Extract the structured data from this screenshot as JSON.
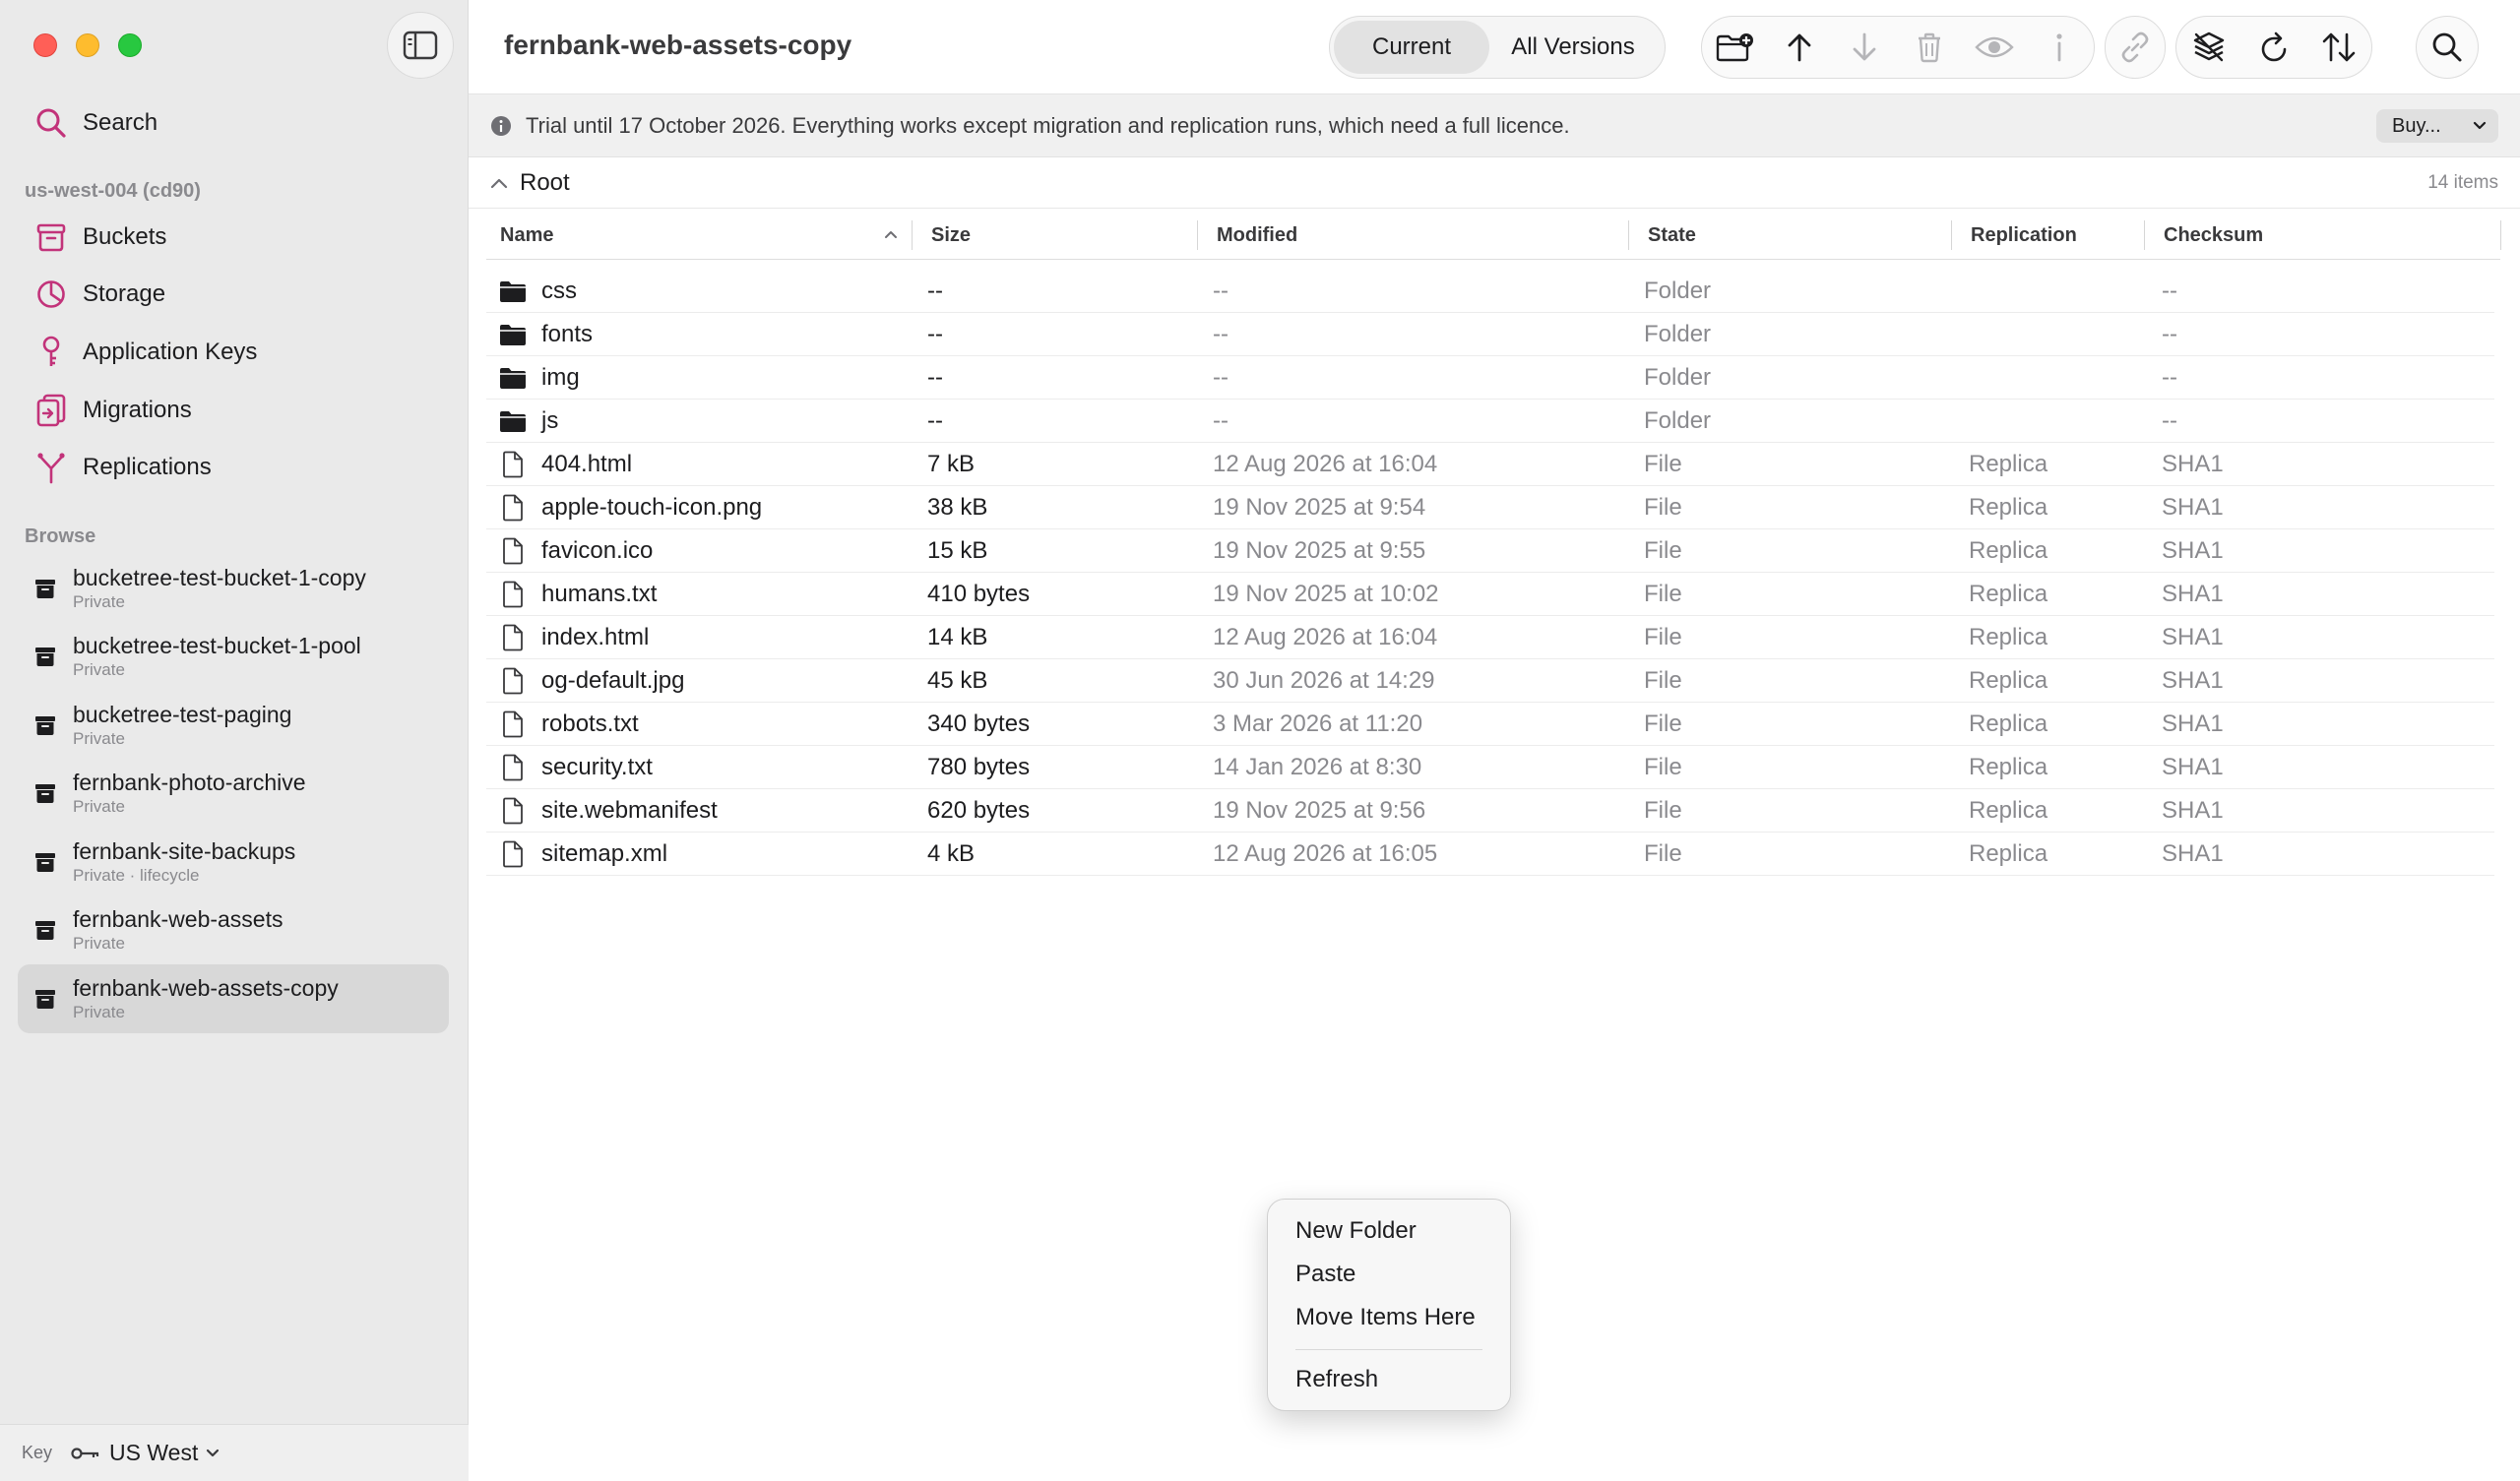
{
  "window": {
    "title": "fernbank-web-assets-copy"
  },
  "sidebar": {
    "search_label": "Search",
    "region_header": "us-west-004 (cd90)",
    "nav": [
      {
        "label": "Buckets",
        "icon": "bucket-icon"
      },
      {
        "label": "Storage",
        "icon": "pie-chart-icon"
      },
      {
        "label": "Application Keys",
        "icon": "key-icon"
      },
      {
        "label": "Migrations",
        "icon": "migration-icon"
      },
      {
        "label": "Replications",
        "icon": "replication-icon"
      }
    ],
    "browse_label": "Browse",
    "buckets": [
      {
        "name": "bucketree-test-bucket-1-copy",
        "sub": "Private"
      },
      {
        "name": "bucketree-test-bucket-1-pool",
        "sub": "Private"
      },
      {
        "name": "bucketree-test-paging",
        "sub": "Private"
      },
      {
        "name": "fernbank-photo-archive",
        "sub": "Private"
      },
      {
        "name": "fernbank-site-backups",
        "sub": "Private · lifecycle"
      },
      {
        "name": "fernbank-web-assets",
        "sub": "Private"
      },
      {
        "name": "fernbank-web-assets-copy",
        "sub": "Private",
        "selected": true
      }
    ],
    "footer": {
      "key_label": "Key",
      "region": "US West"
    }
  },
  "toolbar": {
    "segments": {
      "current": "Current",
      "all_versions": "All Versions",
      "selected": "current"
    },
    "icons": [
      "new-folder-icon",
      "upload-icon",
      "download-icon",
      "trash-icon",
      "preview-eye-icon",
      "info-icon",
      "link-icon",
      "layers-icon",
      "refresh-icon",
      "sort-icon",
      "search-icon"
    ]
  },
  "banner": {
    "text": "Trial until 17 October 2026. Everything works except migration and replication runs, which need a full licence.",
    "buy_label": "Buy..."
  },
  "pathbar": {
    "root": "Root",
    "count": "14 items"
  },
  "table": {
    "columns": {
      "name": "Name",
      "size": "Size",
      "modified": "Modified",
      "state": "State",
      "replication": "Replication",
      "checksum": "Checksum"
    },
    "sort_column": "name",
    "sort_direction": "ascending",
    "rows": [
      {
        "name": "css",
        "type": "folder",
        "size": "--",
        "modified": "--",
        "state": "Folder",
        "replication": "",
        "checksum": "--"
      },
      {
        "name": "fonts",
        "type": "folder",
        "size": "--",
        "modified": "--",
        "state": "Folder",
        "replication": "",
        "checksum": "--"
      },
      {
        "name": "img",
        "type": "folder",
        "size": "--",
        "modified": "--",
        "state": "Folder",
        "replication": "",
        "checksum": "--"
      },
      {
        "name": "js",
        "type": "folder",
        "size": "--",
        "modified": "--",
        "state": "Folder",
        "replication": "",
        "checksum": "--"
      },
      {
        "name": "404.html",
        "type": "file",
        "size": "7 kB",
        "modified": "12 Aug 2026 at 16:04",
        "state": "File",
        "replication": "Replica",
        "checksum": "SHA1"
      },
      {
        "name": "apple-touch-icon.png",
        "type": "file",
        "size": "38 kB",
        "modified": "19 Nov 2025 at 9:54",
        "state": "File",
        "replication": "Replica",
        "checksum": "SHA1"
      },
      {
        "name": "favicon.ico",
        "type": "file",
        "size": "15 kB",
        "modified": "19 Nov 2025 at 9:55",
        "state": "File",
        "replication": "Replica",
        "checksum": "SHA1"
      },
      {
        "name": "humans.txt",
        "type": "file",
        "size": "410 bytes",
        "modified": "19 Nov 2025 at 10:02",
        "state": "File",
        "replication": "Replica",
        "checksum": "SHA1"
      },
      {
        "name": "index.html",
        "type": "file",
        "size": "14 kB",
        "modified": "12 Aug 2026 at 16:04",
        "state": "File",
        "replication": "Replica",
        "checksum": "SHA1"
      },
      {
        "name": "og-default.jpg",
        "type": "file",
        "size": "45 kB",
        "modified": "30 Jun 2026 at 14:29",
        "state": "File",
        "replication": "Replica",
        "checksum": "SHA1"
      },
      {
        "name": "robots.txt",
        "type": "file",
        "size": "340 bytes",
        "modified": "3 Mar 2026 at 11:20",
        "state": "File",
        "replication": "Replica",
        "checksum": "SHA1"
      },
      {
        "name": "security.txt",
        "type": "file",
        "size": "780 bytes",
        "modified": "14 Jan 2026 at 8:30",
        "state": "File",
        "replication": "Replica",
        "checksum": "SHA1"
      },
      {
        "name": "site.webmanifest",
        "type": "file",
        "size": "620 bytes",
        "modified": "19 Nov 2025 at 9:56",
        "state": "File",
        "replication": "Replica",
        "checksum": "SHA1"
      },
      {
        "name": "sitemap.xml",
        "type": "file",
        "size": "4 kB",
        "modified": "12 Aug 2026 at 16:05",
        "state": "File",
        "replication": "Replica",
        "checksum": "SHA1"
      }
    ]
  },
  "context_menu": {
    "items": [
      "New Folder",
      "Paste",
      "Move Items Here"
    ],
    "after_separator": [
      "Refresh"
    ]
  },
  "colors": {
    "accent": "#c2337a",
    "sidebar_bg": "#eaeaea",
    "banner_bg": "#f0f0f0",
    "selection": "#d8d8d8"
  }
}
